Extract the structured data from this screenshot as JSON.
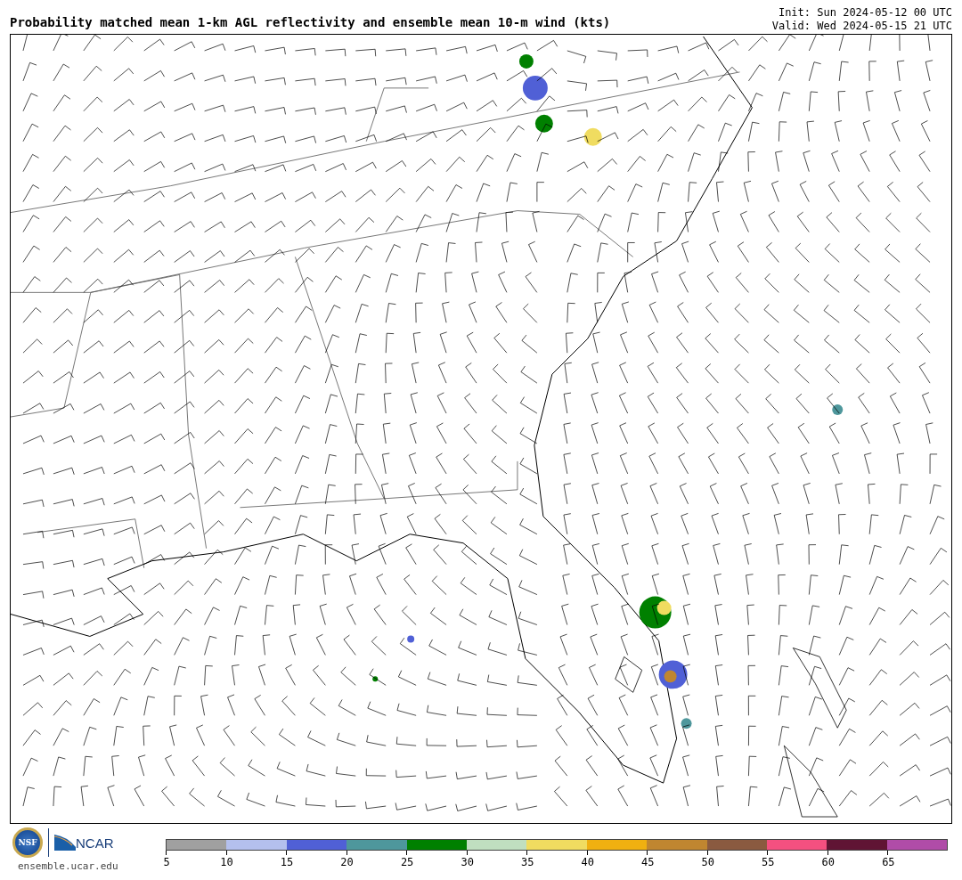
{
  "title": "Probability matched mean 1-km AGL reflectivity and ensemble mean 10-m wind (kts)",
  "init": "Init: Sun 2024-05-12 00 UTC",
  "valid": "Valid: Wed 2024-05-15 21 UTC",
  "logos": {
    "nsf": "NSF",
    "ncar": "NCAR",
    "site": "ensemble.ucar.edu"
  },
  "legend": [
    {
      "label": "5",
      "color": "#a0a0a0"
    },
    {
      "label": "10",
      "color": "#b4c0ee"
    },
    {
      "label": "15",
      "color": "#5060d6"
    },
    {
      "label": "20",
      "color": "#4e979c"
    },
    {
      "label": "25",
      "color": "#008000"
    },
    {
      "label": "30",
      "color": "#c0dfc0"
    },
    {
      "label": "35",
      "color": "#f0dc60"
    },
    {
      "label": "40",
      "color": "#f0b010"
    },
    {
      "label": "45",
      "color": "#c08630"
    },
    {
      "label": "50",
      "color": "#8a5a40"
    },
    {
      "label": "55",
      "color": "#f45080"
    },
    {
      "label": "60",
      "color": "#601434"
    },
    {
      "label": "65",
      "color": "#b04ca8"
    }
  ]
}
